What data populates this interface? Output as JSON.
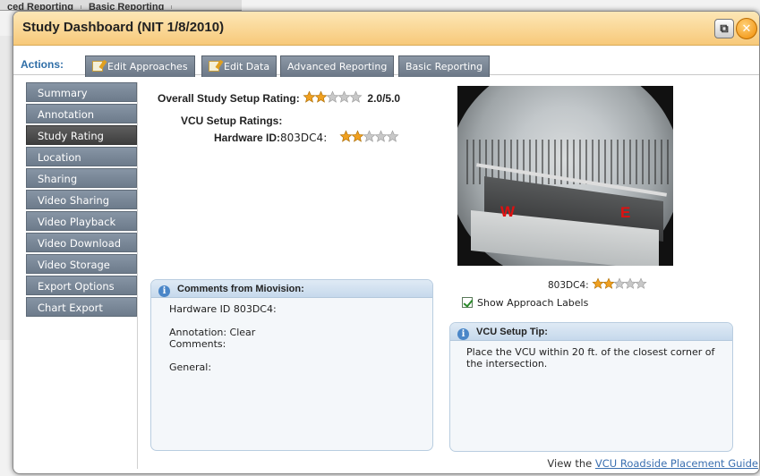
{
  "window": {
    "title": "Study Dashboard (NIT 1/8/2010)",
    "restore_icon": "restore-window-icon",
    "close_icon": "close-icon"
  },
  "background": {
    "tabs": [
      "ced Reporting",
      "Basic Reporting"
    ]
  },
  "actions": {
    "label": "Actions:",
    "tabs": [
      {
        "label": "Edit Approaches",
        "icon": "edit-icon"
      },
      {
        "label": "Edit Data",
        "icon": "edit-icon"
      },
      {
        "label": "Advanced Reporting"
      },
      {
        "label": "Basic Reporting"
      }
    ]
  },
  "sidebar": {
    "items": [
      {
        "label": "Summary"
      },
      {
        "label": "Annotation"
      },
      {
        "label": "Study Rating",
        "active": true
      },
      {
        "label": "Location"
      },
      {
        "label": "Sharing"
      },
      {
        "label": "Video Sharing"
      },
      {
        "label": "Video Playback"
      },
      {
        "label": "Video Download"
      },
      {
        "label": "Video Storage"
      },
      {
        "label": "Export Options"
      },
      {
        "label": "Chart Export"
      }
    ]
  },
  "rating": {
    "overall_label": "Overall Study Setup Rating:",
    "overall_value": "2.0/5.0",
    "overall_stars": 2,
    "vcu_heading": "VCU Setup Ratings:",
    "hardware_label": "Hardware ID:",
    "hardware_id": "803DC4:",
    "hardware_stars": 2
  },
  "camera": {
    "label_w": "W",
    "label_e": "E",
    "caption": "803DC4:",
    "caption_stars": 2,
    "show_labels_text": "Show Approach Labels",
    "show_labels_checked": true
  },
  "comments": {
    "title": "Comments from Miovision:",
    "lines": [
      "Hardware ID 803DC4:",
      "",
      "Annotation: Clear",
      "Comments:",
      "",
      "General:"
    ]
  },
  "tip": {
    "title": "VCU Setup Tip:",
    "text": "Place the VCU within 20 ft. of the closest corner of the intersection."
  },
  "footer": {
    "prefix": "View the",
    "link": "VCU Roadside Placement Guide"
  },
  "colors": {
    "star_filled": "#f0a020",
    "star_empty": "#c8c8c8",
    "accent_blue": "#2f6ea7",
    "titlebar": "#f7c97a"
  }
}
